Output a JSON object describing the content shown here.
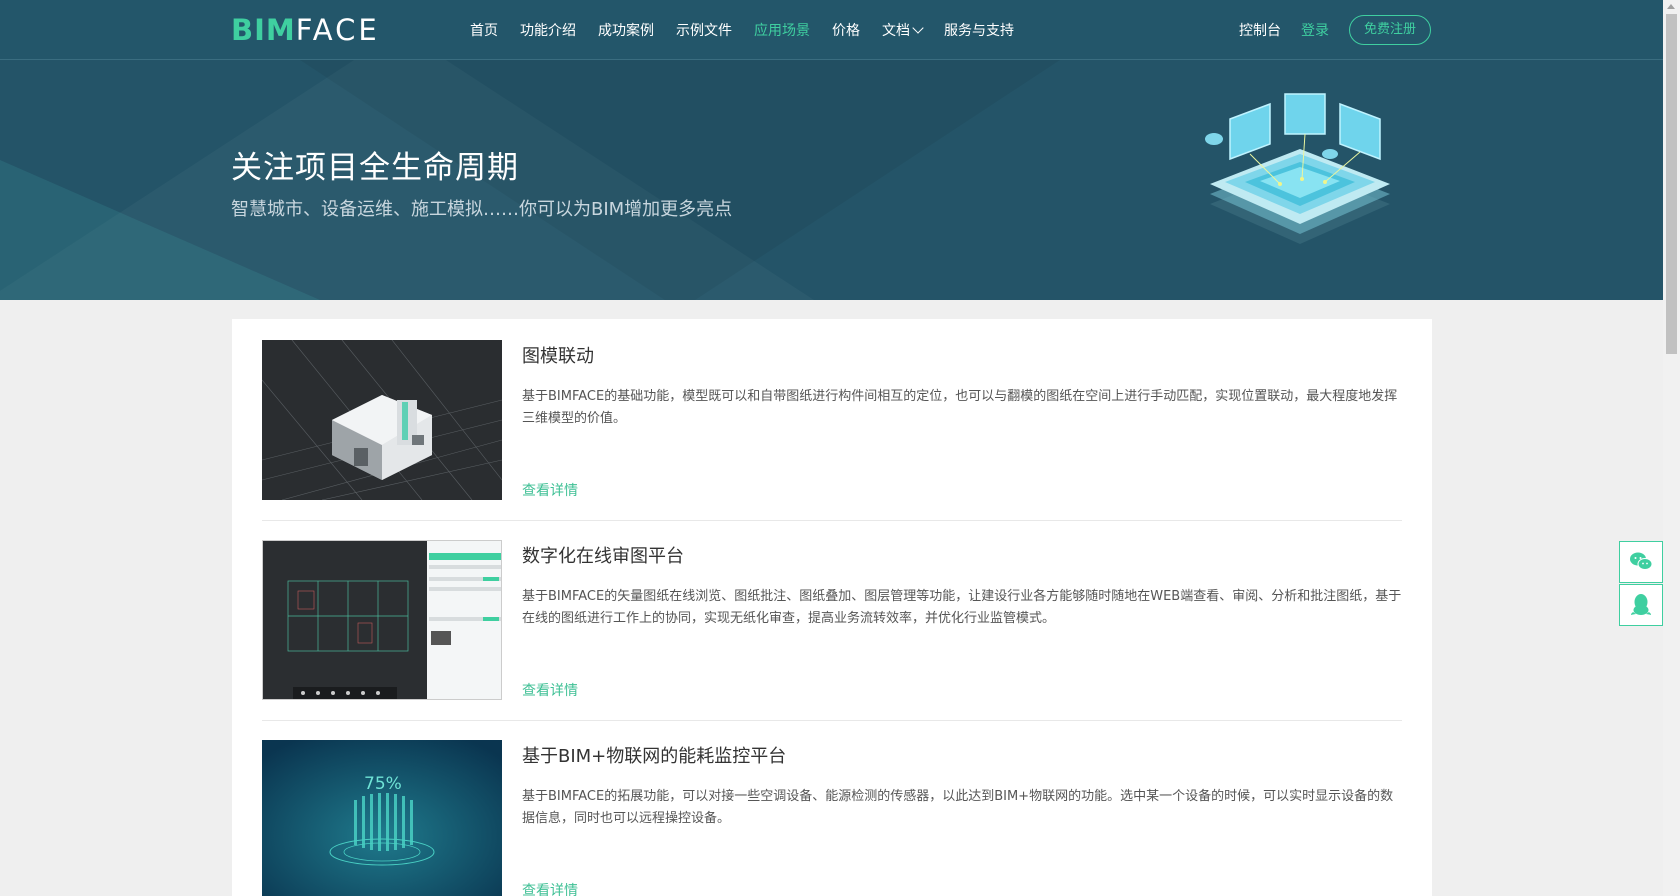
{
  "nav": {
    "logo_bim": "BIM",
    "logo_face": "FACE",
    "items": [
      {
        "label": "首页",
        "active": false
      },
      {
        "label": "功能介绍",
        "active": false
      },
      {
        "label": "成功案例",
        "active": false
      },
      {
        "label": "示例文件",
        "active": false
      },
      {
        "label": "应用场景",
        "active": true
      },
      {
        "label": "价格",
        "active": false
      },
      {
        "label": "文档",
        "active": false,
        "dropdown": true
      },
      {
        "label": "服务与支持",
        "active": false
      }
    ],
    "console": "控制台",
    "login": "登录",
    "register": "免费注册"
  },
  "hero": {
    "title": "关注项目全生命周期",
    "subtitle": "智慧城市、设备运维、施工模拟……你可以为BIM增加更多亮点"
  },
  "scenarios": [
    {
      "title": "图模联动",
      "desc": "基于BIMFACE的基础功能，模型既可以和自带图纸进行构件间相互的定位，也可以与翻模的图纸在空间上进行手动匹配，实现位置联动，最大程度地发挥三维模型的价值。",
      "more": "查看详情"
    },
    {
      "title": "数字化在线审图平台",
      "desc": "基于BIMFACE的矢量图纸在线浏览、图纸批注、图纸叠加、图层管理等功能，让建设行业各方能够随时随地在WEB端查看、审阅、分析和批注图纸，基于在线的图纸进行工作上的协同，实现无纸化审查，提高业务流转效率，并优化行业监管模式。",
      "more": "查看详情"
    },
    {
      "title": "基于BIM+物联网的能耗监控平台",
      "desc": "基于BIMFACE的拓展功能，可以对接一些空调设备、能源检测的传感器，以此达到BIM+物联网的功能。选中某一个设备的时候，可以实时显示设备的数据信息，同时也可以远程操控设备。",
      "more": "查看详情",
      "thumb_label": "75%"
    }
  ],
  "colors": {
    "nav_bg": "#23566a",
    "hero_bg": "#245468",
    "accent": "#3fcfa0",
    "link": "#3fc095"
  },
  "icons": {
    "side_top": "wechat-icon",
    "side_bottom": "qq-icon"
  }
}
